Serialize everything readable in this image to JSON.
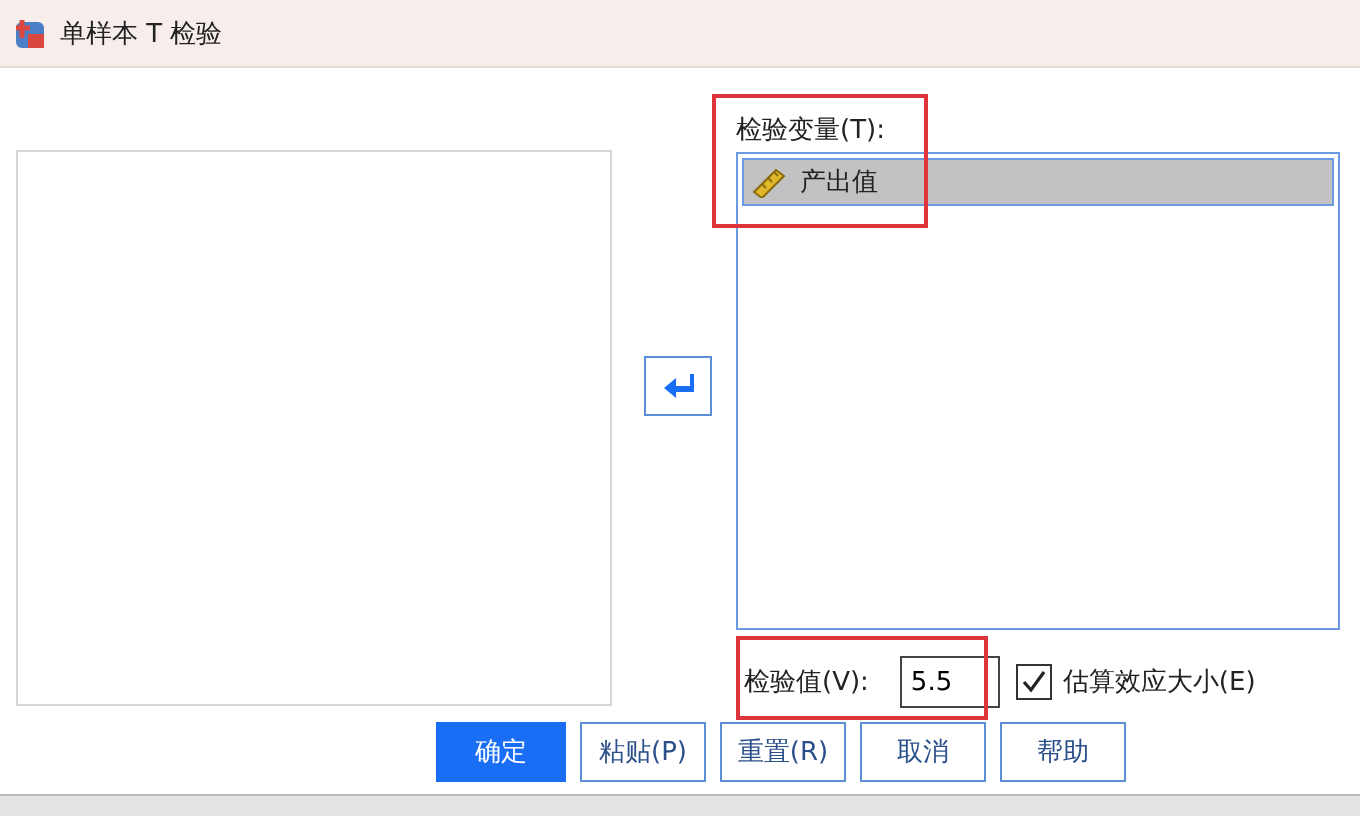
{
  "window": {
    "title": "单样本 T 检验"
  },
  "test_variables": {
    "label": "检验变量(T):",
    "highlighted": true,
    "items": [
      {
        "name": "产出值",
        "kind": "scale",
        "selected": true
      }
    ]
  },
  "test_value": {
    "label": "检验值(V):",
    "value": "5.5",
    "highlighted": true
  },
  "effect_size": {
    "label": "估算效应大小(E)",
    "checked": true
  },
  "buttons": [
    {
      "label": "确定",
      "primary": true
    },
    {
      "label": "粘贴(P)",
      "primary": false
    },
    {
      "label": "重置(R)",
      "primary": false
    },
    {
      "label": "取消",
      "primary": false
    },
    {
      "label": "帮助",
      "primary": false
    }
  ]
}
